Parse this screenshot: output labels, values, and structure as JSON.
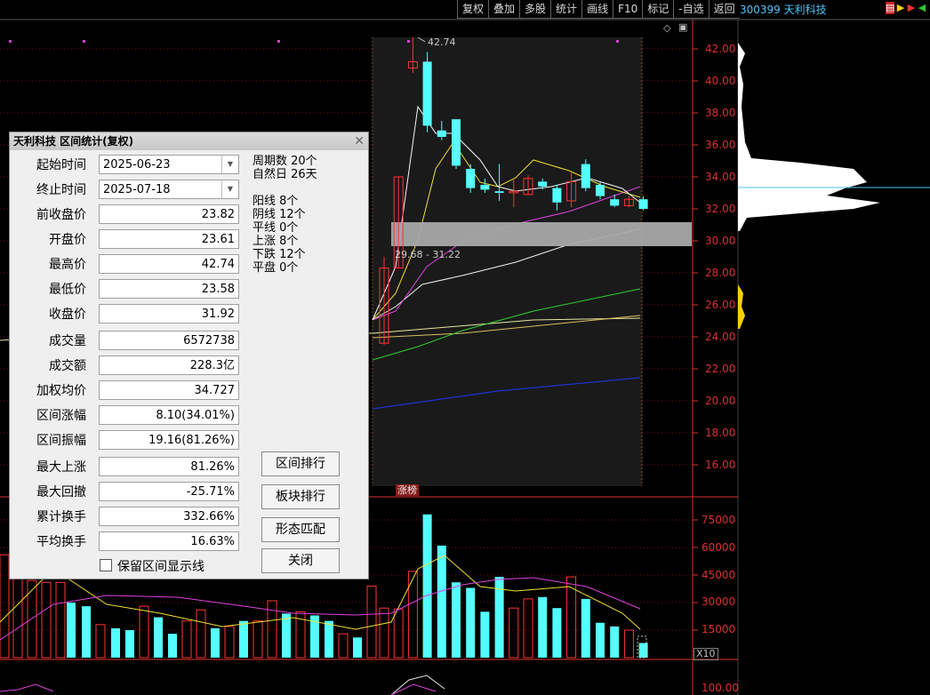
{
  "toolbar": {
    "items": [
      "复权",
      "叠加",
      "多股",
      "统计",
      "画线",
      "F10",
      "标记",
      "-自选",
      "返回"
    ]
  },
  "stock": {
    "title": "300399 天利科技"
  },
  "chart_data": [
    {
      "type": "candlestick",
      "name": "price",
      "candles": [
        {
          "o": 23.6,
          "c": 28.3,
          "h": 29.0,
          "l": 23.5
        },
        {
          "o": 28.3,
          "c": 34.0,
          "h": 34.0,
          "l": 28.3
        },
        {
          "o": 40.8,
          "c": 41.2,
          "h": 42.74,
          "l": 40.5
        },
        {
          "o": 41.2,
          "c": 37.2,
          "h": 41.8,
          "l": 36.8
        },
        {
          "o": 36.9,
          "c": 36.5,
          "h": 37.5,
          "l": 36.3
        },
        {
          "o": 37.6,
          "c": 34.7,
          "h": 37.6,
          "l": 34.5
        },
        {
          "o": 34.5,
          "c": 33.3,
          "h": 34.8,
          "l": 33.0
        },
        {
          "o": 33.5,
          "c": 33.2,
          "h": 33.9,
          "l": 33.0
        },
        {
          "o": 33.1,
          "c": 33.0,
          "h": 34.8,
          "l": 32.5
        },
        {
          "o": 33.0,
          "c": 33.1,
          "h": 33.9,
          "l": 32.1
        },
        {
          "o": 32.9,
          "c": 33.9,
          "h": 34.1,
          "l": 32.9
        },
        {
          "o": 33.7,
          "c": 33.4,
          "h": 33.9,
          "l": 33.2
        },
        {
          "o": 33.3,
          "c": 32.4,
          "h": 33.5,
          "l": 31.9
        },
        {
          "o": 32.5,
          "c": 33.7,
          "h": 34.4,
          "l": 32.1
        },
        {
          "o": 34.8,
          "c": 33.3,
          "h": 35.1,
          "l": 33.1
        },
        {
          "o": 33.5,
          "c": 32.8,
          "h": 33.7,
          "l": 32.6
        },
        {
          "o": 32.6,
          "c": 32.2,
          "h": 32.9,
          "l": 32.1
        },
        {
          "o": 32.2,
          "c": 32.6,
          "h": 32.8,
          "l": 32.1
        },
        {
          "o": 32.6,
          "c": 32.0,
          "h": 32.8,
          "l": 31.9
        }
      ],
      "ylim": [
        15,
        43
      ],
      "y_ticks": [
        "42.00",
        "40.00",
        "38.00",
        "36.00",
        "34.00",
        "32.00",
        "30.00",
        "28.00",
        "26.00",
        "24.00",
        "22.00",
        "20.00",
        "18.00",
        "16.00"
      ],
      "annotations": {
        "high_label": "42.74",
        "range_label": "29.68 - 31.22"
      }
    },
    {
      "type": "bar",
      "name": "volume",
      "y_ticks": [
        "75000",
        "60000",
        "45000",
        "30000",
        "15000"
      ],
      "values": [
        27000,
        26500,
        47000,
        78000,
        61000,
        41000,
        38000,
        25000,
        44000,
        27000,
        32000,
        33000,
        27000,
        44000,
        32000,
        19000,
        17000,
        15000,
        8000
      ]
    }
  ],
  "axis_extra": {
    "bottom_tick": "100.00",
    "scale_label": "X10"
  },
  "zhangting_label": "涨榜",
  "dialog": {
    "title": "天利科技 区间统计(复权)",
    "start_label": "起始时间",
    "start_value": "2025-06-23",
    "end_label": "终止时间",
    "end_value": "2025-07-18",
    "rows": [
      {
        "label": "前收盘价",
        "value": "23.82"
      },
      {
        "label": "开盘价",
        "value": "23.61"
      },
      {
        "label": "最高价",
        "value": "42.74"
      },
      {
        "label": "最低价",
        "value": "23.58"
      },
      {
        "label": "收盘价",
        "value": "31.92"
      },
      {
        "label": "成交量",
        "value": "6572738"
      },
      {
        "label": "成交额",
        "value": "228.3亿"
      },
      {
        "label": "加权均价",
        "value": "34.727"
      },
      {
        "label": "区间涨幅",
        "value": "8.10(34.01%)"
      },
      {
        "label": "区间振幅",
        "value": "19.16(81.26%)"
      },
      {
        "label": "最大上涨",
        "value": "81.26%"
      },
      {
        "label": "最大回撤",
        "value": "-25.71%"
      },
      {
        "label": "累计换手",
        "value": "332.66%"
      },
      {
        "label": "平均换手",
        "value": "16.63%"
      }
    ],
    "stats": [
      "周期数 20个",
      "自然日 26天",
      "",
      "阳线 8个",
      "阴线 12个",
      "平线 0个",
      "上涨 8个",
      "下跌 12个",
      "平盘 0个"
    ],
    "buttons": {
      "rank": "区间排行",
      "sector": "板块排行",
      "pattern": "形态匹配",
      "close": "关闭"
    },
    "checkbox_label": "保留区间显示线"
  },
  "colors": {
    "up": "#ff3333",
    "down": "#54ffff",
    "axis": "#dd3030"
  }
}
